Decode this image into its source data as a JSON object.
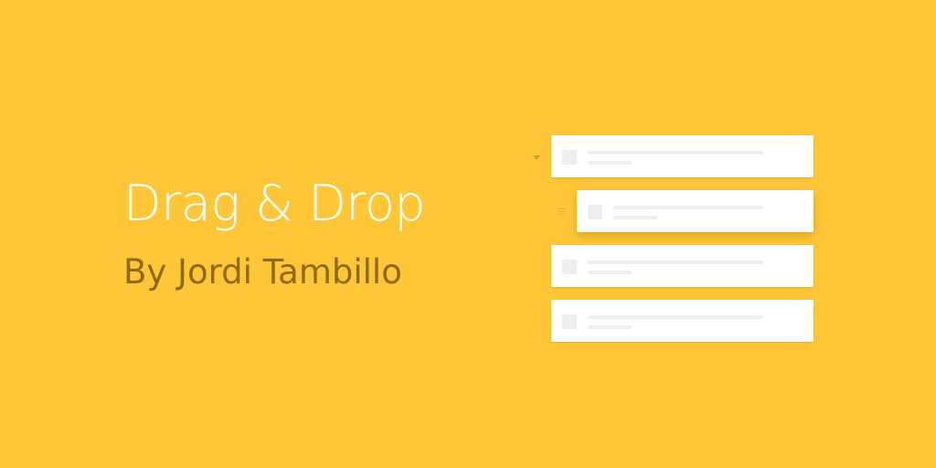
{
  "hero": {
    "title": "Drag & Drop",
    "subtitle": "By Jordi Tambillo"
  },
  "colors": {
    "background": "#FFC738",
    "title": "#FFFFFF",
    "subtitle": "#8C6A16",
    "card": "#FFFFFF",
    "placeholder": "#EEEEEE"
  },
  "list_illustration": {
    "items": [
      {
        "state": "collapsed-indicator"
      },
      {
        "state": "dragging"
      },
      {
        "state": "idle"
      },
      {
        "state": "idle"
      }
    ]
  }
}
